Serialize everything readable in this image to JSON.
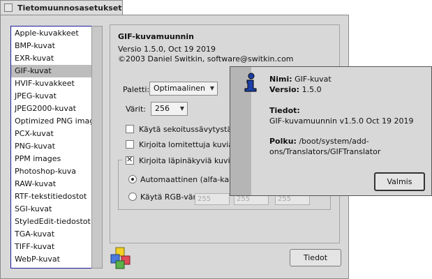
{
  "window": {
    "title": "Tietomuunnosasetukset"
  },
  "translators": [
    "Apple-kuvakkeet",
    "BMP-kuvat",
    "EXR-kuvat",
    "GIF-kuvat",
    "HVIF-kuvakkeet",
    "JPEG-kuvat",
    "JPEG2000-kuvat",
    "Optimized PNG image",
    "PCX-kuvat",
    "PNG-kuvat",
    "PPM images",
    "Photoshop-kuva",
    "RAW-kuvat",
    "RTF-tekstitiedostot",
    "SGI-kuvat",
    "StyledEdit-tiedostot",
    "TGA-kuvat",
    "TIFF-kuvat",
    "WebP-kuvat"
  ],
  "selected_translator": "GIF-kuvat",
  "settings": {
    "name": "GIF-kuvamuunnin",
    "version": "Versio 1.5.0, Oct 19 2019",
    "copyright": "©2003 Daniel Switkin, software@switkin.com",
    "palette_label": "Paletti:",
    "palette_value": "Optimaalinen",
    "colors_label": "Värit:",
    "colors_value": "256",
    "dither_label": "Käytä sekoitussävytystä",
    "dither_checked": false,
    "interlace_label": "Kirjoita lomitettuja kuvia",
    "interlace_checked": false,
    "transparent_label": "Kirjoita läpinäkyviä kuvia",
    "transparent_checked": true,
    "auto_label": "Automaattinen (alfa-kanavalt",
    "auto_selected": true,
    "rgb_label": "Käytä RGB-väriä",
    "rgb_selected": false,
    "rgb_values": [
      "255",
      "255",
      "255"
    ]
  },
  "info_button": "Tiedot",
  "about": {
    "name_label": "Nimi:",
    "name_value": "GIF-kuvat",
    "version_label": "Versio:",
    "version_value": "1.5.0",
    "info_label": "Tiedot:",
    "info_value": "GIF-kuvamuunnin v1.5.0 Oct 19 2019",
    "path_label": "Polku:",
    "path_line1": "/boot/system/add-",
    "path_line2": "ons/Translators/GIFTranslator",
    "ok_button": "Valmis"
  },
  "colors": {
    "window_bg": "#d8d8d8",
    "list_border": "#1a1a9a",
    "selection": "#bdbdbd"
  }
}
